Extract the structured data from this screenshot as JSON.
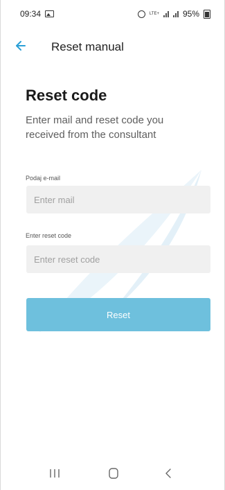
{
  "status_bar": {
    "time": "09:34",
    "battery": "95%",
    "network_label": "LTE+"
  },
  "app_bar": {
    "title": "Reset manual",
    "back_icon": "arrow-left-icon"
  },
  "content": {
    "headline": "Reset code",
    "subtitle": "Enter mail and reset code you received from the consultant"
  },
  "form": {
    "email_label": "Podaj e-mail",
    "email_placeholder": "Enter mail",
    "email_value": "",
    "code_label": "Enter reset code",
    "code_placeholder": "Enter reset code",
    "code_value": ""
  },
  "actions": {
    "reset_label": "Reset"
  },
  "nav_bar": {
    "recents_icon": "recents-icon",
    "home_icon": "home-icon",
    "back_icon": "chevron-left-icon"
  },
  "colors": {
    "accent": "#2a9fd6",
    "button": "#6ec0dd",
    "field_bg": "#f0f0f0",
    "watermark": "#eaf4fa"
  }
}
